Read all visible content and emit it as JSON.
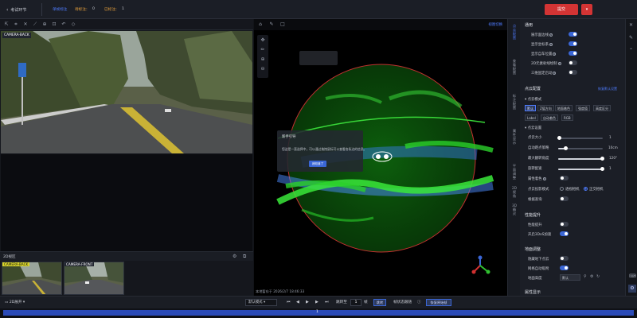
{
  "header": {
    "back_label": "考试环节",
    "stats_title": "单帧标注",
    "stat1_label": "待标注：",
    "stat1_value": "0",
    "stat2_label": "已标注：",
    "stat2_value": "1",
    "submit_label": "提交",
    "dropdown_label": "▾"
  },
  "left_panel": {
    "camera_main_tag": "CAMERA-BACK",
    "thumb_section_title": "2D视区",
    "thumbs": [
      {
        "tag": "CAMERA-BACK"
      },
      {
        "tag": "CAMERA-FRONT"
      }
    ]
  },
  "viewer": {
    "link_label": "视图切换",
    "popup_title": "新手引导",
    "popup_body": "您这是一直选择中，可以通过拖拽鼠标可以查看各条边的信息。",
    "popup_button": "我知道了",
    "footer_time": "本地暂存于 2026/2/7 18:46:33"
  },
  "vtabs": [
    {
      "label": "点云配置",
      "active": true
    },
    {
      "label": "查看配置",
      "active": false
    },
    {
      "label": "标注配置",
      "active": false
    },
    {
      "label": "属性显示",
      "active": false
    },
    {
      "label": "平面调整",
      "active": false
    },
    {
      "label": "2D视角",
      "active": false
    },
    {
      "label": "3D精灵",
      "active": false
    }
  ],
  "settings": {
    "general_title": "通用",
    "general_rows": [
      {
        "label": "展示面边线",
        "on": true
      },
      {
        "label": "显示坐标系",
        "on": true
      },
      {
        "label": "显示自车位置",
        "on": true
      },
      {
        "label": "2D元素射线绘制",
        "on": false
      },
      {
        "label": "三维固定启动",
        "on": false
      }
    ],
    "pc_title": "点云配置",
    "pc_restore": "恢复默认设置",
    "color_mode_title": "点云模式",
    "color_chips": [
      "默认",
      "Z值方向",
      "地面着色",
      "强度值",
      "高度区分",
      "Label",
      "自动着色",
      "RGB"
    ],
    "point_settings_title": "点云设置",
    "point_size_label": "点云大小",
    "point_size_value": "1",
    "auto_range_label": "自动距点策略",
    "auto_range_value": "10cm",
    "max_angle_label": "最大翻转角度",
    "max_angle_value": "120°",
    "rotate_label": "旋转配速",
    "rotate_value": "1",
    "attr_label": "属性着色",
    "projection_label": "点云投影模式",
    "proj_opt1": "透视相机",
    "proj_opt2": "正交相机",
    "filter_label": "根据查询",
    "perf_title": "性能提升",
    "perf1_label": "性能提升",
    "perf2_label": "开启3DoS加速",
    "ground_title": "地面调整",
    "ground1_label": "隐藏地下点云",
    "ground2_label": "网格自动吸附",
    "ground_height_label": "地面高度",
    "ground_height_value": "默认",
    "attr_display_title": "属性显示"
  },
  "bottom": {
    "view_label": "2D展开",
    "mode_value": "默认模式",
    "jump_label": "跳转至",
    "frame_value": "1",
    "frame_unit": "帧",
    "jump_button": "跳转",
    "follow_label": "帧状态跟随",
    "restore_button": "恢复原始帧",
    "timeline_value": "1"
  }
}
